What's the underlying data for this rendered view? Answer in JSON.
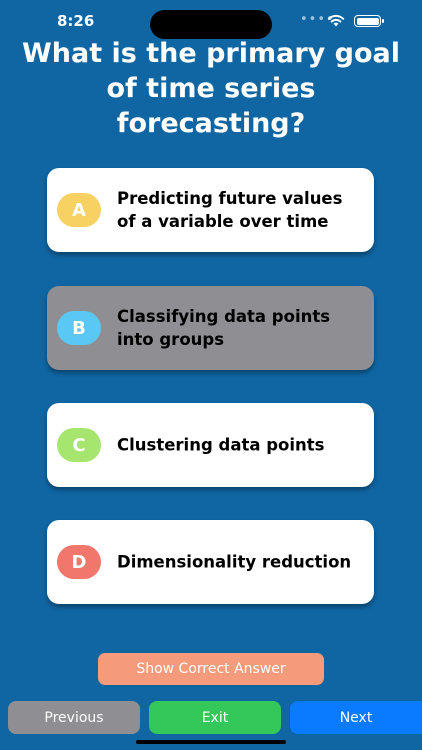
{
  "status": {
    "time": "8:26",
    "signal": "••••"
  },
  "question": "What is the primary goal of time series forecasting?",
  "colors": {
    "background": "#0f66a3",
    "badge_a": "#f8d163",
    "badge_b": "#5ac8f4",
    "badge_c": "#a6e66e",
    "badge_d": "#f1766c",
    "selected": "#8e8e93",
    "show_answer": "#f59a7a",
    "previous": "#8e8e93",
    "exit": "#34c759",
    "next": "#0a7aff"
  },
  "answers": [
    {
      "letter": "A",
      "text": "Predicting future values of a variable over time",
      "selected": false
    },
    {
      "letter": "B",
      "text": "Classifying data points into groups",
      "selected": true
    },
    {
      "letter": "C",
      "text": "Clustering data points",
      "selected": false
    },
    {
      "letter": "D",
      "text": "Dimensionality reduction",
      "selected": false
    }
  ],
  "buttons": {
    "show_answer": "Show Correct Answer",
    "previous": "Previous",
    "exit": "Exit",
    "next": "Next"
  },
  "icons": {
    "wifi": "wifi-icon",
    "battery": "battery-icon"
  }
}
